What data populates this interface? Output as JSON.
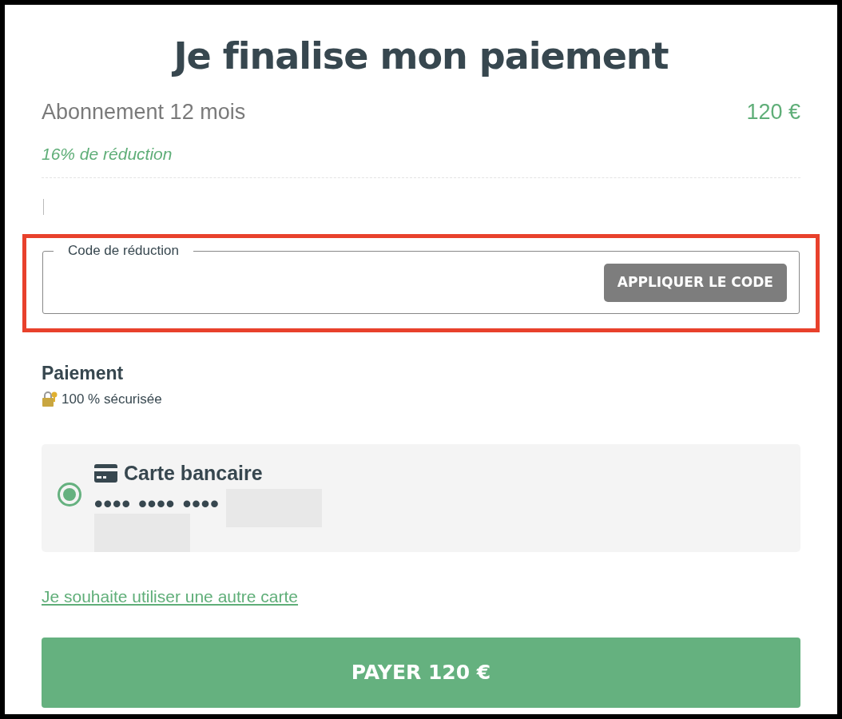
{
  "title": "Je finalise mon paiement",
  "plan": {
    "name": "Abonnement 12 mois",
    "price": "120 €",
    "discount": "16% de réduction"
  },
  "promo": {
    "label": "Code de réduction",
    "button": {
      "label": "APPLIQUER LE CODE",
      "disabled": true
    },
    "highlighted": true
  },
  "payment": {
    "heading": "Paiement",
    "security": "100 % sécurisée",
    "methods": [
      {
        "label": "Carte bancaire",
        "number": "•••• •••• ••••",
        "selected": true
      }
    ]
  },
  "other_card_link": "Je souhaite utiliser une autre carte",
  "pay_button": "PAYER 120 €"
}
